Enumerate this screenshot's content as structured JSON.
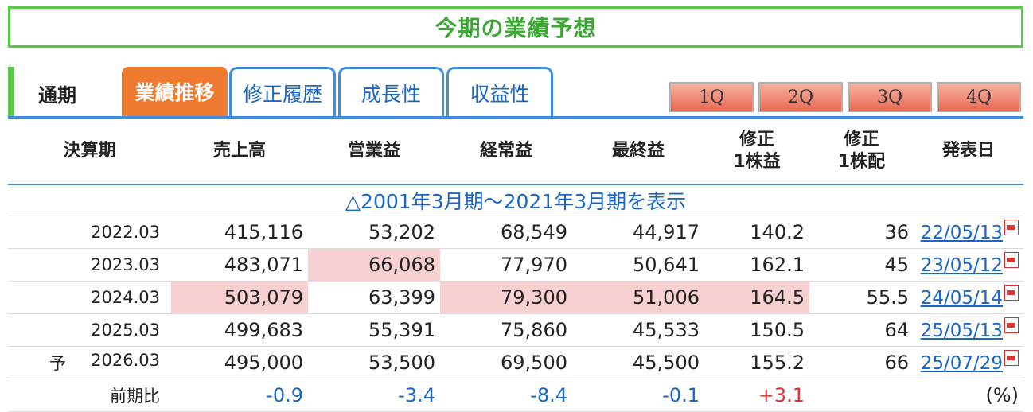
{
  "title": "今期の業績予想",
  "tabs": {
    "plain": "通期",
    "active": "業績推移",
    "links": [
      "修正履歴",
      "成長性",
      "収益性"
    ],
    "quarters": [
      "1Q",
      "2Q",
      "3Q",
      "4Q"
    ]
  },
  "table": {
    "headers": {
      "period": "決算期",
      "sales": "売上高",
      "op": "営業益",
      "ord": "経常益",
      "net": "最終益",
      "eps_l1": "修正",
      "eps_l2": "1株益",
      "div_l1": "修正",
      "div_l2": "1株配",
      "date": "発表日"
    },
    "expand_text": "△2001年3月期〜2021年3月期を表示",
    "rows": [
      {
        "period": "2022.03",
        "sales": "415,116",
        "op": "53,202",
        "ord": "68,549",
        "net": "44,917",
        "eps": "140.2",
        "div": "36",
        "date": "22/05/13"
      },
      {
        "period": "2023.03",
        "sales": "483,071",
        "op": "66,068",
        "ord": "77,970",
        "net": "50,641",
        "eps": "162.1",
        "div": "45",
        "date": "23/05/12"
      },
      {
        "period": "2024.03",
        "sales": "503,079",
        "op": "63,399",
        "ord": "79,300",
        "net": "51,006",
        "eps": "164.5",
        "div": "55.5",
        "date": "24/05/14"
      },
      {
        "period": "2025.03",
        "sales": "499,683",
        "op": "55,391",
        "ord": "75,860",
        "net": "45,533",
        "eps": "150.5",
        "div": "64",
        "date": "25/05/13"
      },
      {
        "period": "2026.03",
        "forecast_mark": "予",
        "sales": "495,000",
        "op": "53,500",
        "ord": "69,500",
        "net": "45,500",
        "eps": "155.2",
        "div": "66",
        "date": "25/07/29"
      }
    ],
    "change": {
      "label": "前期比",
      "sales": "-0.9",
      "op": "-3.4",
      "ord": "-8.4",
      "net": "-0.1",
      "eps": "+3.1",
      "unit": "(%)"
    }
  },
  "colors": {
    "green": "#5cc84a",
    "orange": "#f07a30",
    "blue": "#1a66c6",
    "highlight": "#f7d1d1",
    "negative": "#1a66c6",
    "positive": "#e03030"
  }
}
